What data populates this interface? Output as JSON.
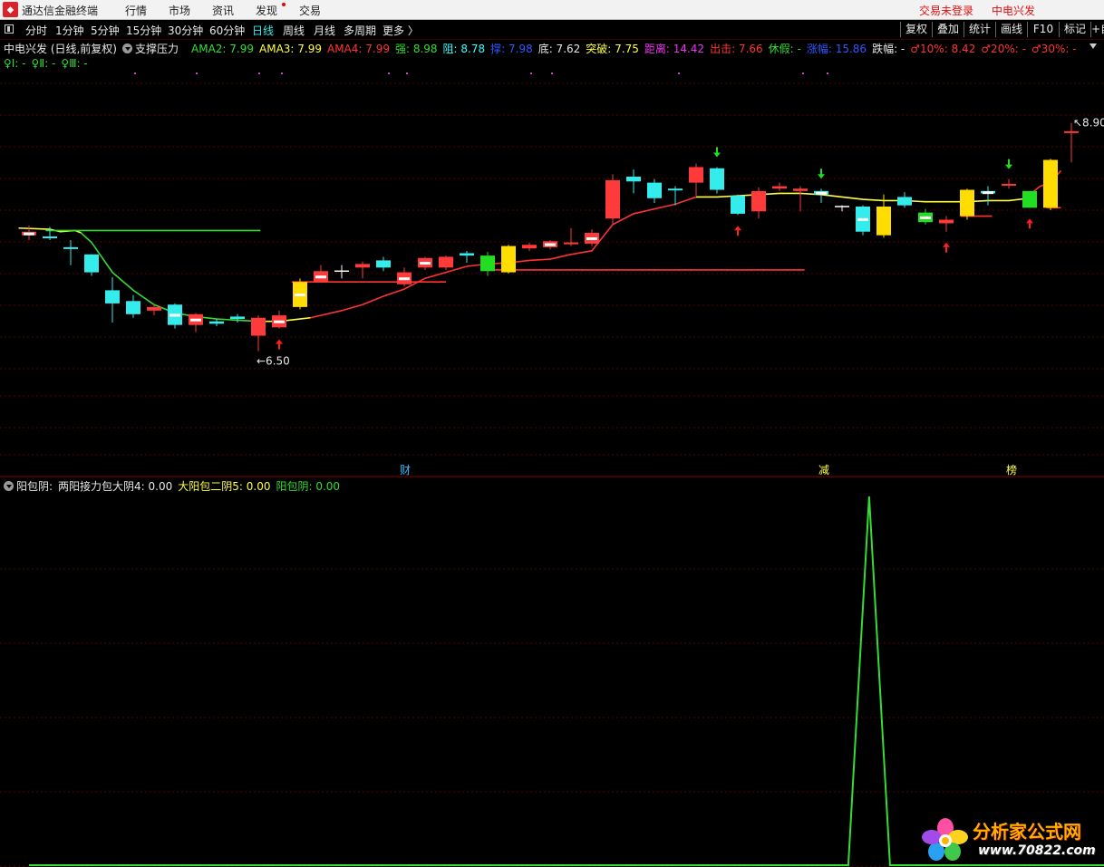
{
  "app": {
    "title": "通达信金融终端",
    "menu": [
      "行情",
      "市场",
      "资讯",
      "发现",
      "交易"
    ],
    "login_status": "交易未登录",
    "stock_name": "中电兴发"
  },
  "periods": [
    "分时",
    "1分钟",
    "5分钟",
    "15分钟",
    "30分钟",
    "60分钟",
    "日线",
    "周线",
    "月线",
    "多周期",
    "更多 〉"
  ],
  "active_period": "日线",
  "tools": [
    "复权",
    "叠加",
    "统计",
    "画线",
    "F10",
    "标记",
    "+自"
  ],
  "main_legend": {
    "title": "中电兴发 (日线,前复权)",
    "indicator": "支撑压力",
    "items": [
      {
        "text": "AMA2: 7.99",
        "color": "#33dd33"
      },
      {
        "text": "AMA3: 7.99",
        "color": "#ffff44"
      },
      {
        "text": "AMA4: 7.99",
        "color": "#ff3333"
      },
      {
        "text": "强: 8.98",
        "color": "#33dd33"
      },
      {
        "text": "阻: 8.78",
        "color": "#33ffff"
      },
      {
        "text": "撑: 7.98",
        "color": "#3355ff"
      },
      {
        "text": "底: 7.62",
        "color": "#e8e8e8"
      },
      {
        "text": "突破: 7.75",
        "color": "#ffff44"
      },
      {
        "text": "距离: 14.42",
        "color": "#ee33ee"
      },
      {
        "text": "出击: 7.66",
        "color": "#ff3333"
      },
      {
        "text": "休假: -",
        "color": "#33dd33"
      },
      {
        "text": "涨幅: 15.86",
        "color": "#3355ff"
      },
      {
        "text": "跌幅: -",
        "color": "#e8e8e8"
      },
      {
        "text": "♂10%: 8.42",
        "color": "#ff3333"
      },
      {
        "text": "♂20%: -",
        "color": "#ff3333"
      },
      {
        "text": "♂30%: -",
        "color": "#ff3333"
      }
    ],
    "line2": [
      {
        "text": "♀Ⅰ: -",
        "color": "#33dd33"
      },
      {
        "text": "♀Ⅱ: -",
        "color": "#33dd33"
      },
      {
        "text": "♀Ⅲ: -",
        "color": "#33dd33"
      }
    ]
  },
  "sub_legend": {
    "indicator": "阳包阴:",
    "items": [
      {
        "text": "两阳接力包大阴4: 0.00",
        "color": "#e8e8e8"
      },
      {
        "text": "大阳包二阴5: 0.00",
        "color": "#ffff44"
      },
      {
        "text": "阳包阴: 0.00",
        "color": "#33dd33"
      }
    ]
  },
  "annotations": {
    "high_label": "8.90",
    "low_label": "6.50",
    "tag_cai": "财",
    "tag_jian": "减",
    "tag_bang": "榜"
  },
  "chart_data": {
    "type": "candlestick",
    "period": "日线",
    "price_axis": {
      "min": 6.2,
      "max": 9.2
    },
    "candles": [
      {
        "o": 7.99,
        "h": 8.04,
        "l": 7.92,
        "c": 7.96,
        "style": "red"
      },
      {
        "o": 7.94,
        "h": 8.03,
        "l": 7.92,
        "c": 7.95,
        "style": "cyan"
      },
      {
        "o": 7.86,
        "h": 7.92,
        "l": 7.71,
        "c": 7.85,
        "style": "cyan"
      },
      {
        "o": 7.8,
        "h": 7.8,
        "l": 7.62,
        "c": 7.65,
        "style": "cyan"
      },
      {
        "o": 7.5,
        "h": 7.61,
        "l": 7.23,
        "c": 7.39,
        "style": "cyan"
      },
      {
        "o": 7.41,
        "h": 7.46,
        "l": 7.27,
        "c": 7.3,
        "style": "cyan"
      },
      {
        "o": 7.33,
        "h": 7.38,
        "l": 7.29,
        "c": 7.36,
        "style": "red"
      },
      {
        "o": 7.38,
        "h": 7.39,
        "l": 7.18,
        "c": 7.21,
        "style": "cyan"
      },
      {
        "o": 7.21,
        "h": 7.31,
        "l": 7.15,
        "c": 7.3,
        "style": "red"
      },
      {
        "o": 7.22,
        "h": 7.26,
        "l": 7.2,
        "c": 7.24,
        "style": "cyan"
      },
      {
        "o": 7.26,
        "h": 7.3,
        "l": 7.23,
        "c": 7.28,
        "style": "cyan"
      },
      {
        "o": 7.12,
        "h": 7.29,
        "l": 6.99,
        "c": 7.27,
        "style": "red"
      },
      {
        "o": 7.19,
        "h": 7.33,
        "l": 7.18,
        "c": 7.29,
        "style": "red"
      },
      {
        "o": 7.36,
        "h": 7.6,
        "l": 7.34,
        "c": 7.57,
        "style": "yellow"
      },
      {
        "o": 7.57,
        "h": 7.71,
        "l": 7.57,
        "c": 7.66,
        "style": "red"
      },
      {
        "o": 7.66,
        "h": 7.71,
        "l": 7.6,
        "c": 7.66,
        "style": "white"
      },
      {
        "o": 7.69,
        "h": 7.74,
        "l": 7.6,
        "c": 7.72,
        "style": "red"
      },
      {
        "o": 7.75,
        "h": 7.78,
        "l": 7.66,
        "c": 7.69,
        "style": "cyan"
      },
      {
        "o": 7.55,
        "h": 7.69,
        "l": 7.53,
        "c": 7.65,
        "style": "red"
      },
      {
        "o": 7.69,
        "h": 7.78,
        "l": 7.67,
        "c": 7.77,
        "style": "red"
      },
      {
        "o": 7.69,
        "h": 7.79,
        "l": 7.67,
        "c": 7.78,
        "style": "red"
      },
      {
        "o": 7.79,
        "h": 7.83,
        "l": 7.73,
        "c": 7.81,
        "style": "cyan"
      },
      {
        "o": 7.79,
        "h": 7.82,
        "l": 7.62,
        "c": 7.66,
        "style": "green"
      },
      {
        "o": 7.65,
        "h": 7.88,
        "l": 7.64,
        "c": 7.87,
        "style": "yellow"
      },
      {
        "o": 7.85,
        "h": 7.9,
        "l": 7.83,
        "c": 7.88,
        "style": "red"
      },
      {
        "o": 7.86,
        "h": 7.92,
        "l": 7.84,
        "c": 7.91,
        "style": "red"
      },
      {
        "o": 7.89,
        "h": 8.02,
        "l": 7.87,
        "c": 7.9,
        "style": "red"
      },
      {
        "o": 7.89,
        "h": 8.01,
        "l": 7.87,
        "c": 7.98,
        "style": "red"
      },
      {
        "o": 8.1,
        "h": 8.47,
        "l": 8.05,
        "c": 8.42,
        "style": "red"
      },
      {
        "o": 8.45,
        "h": 8.51,
        "l": 8.31,
        "c": 8.41,
        "style": "cyan"
      },
      {
        "o": 8.4,
        "h": 8.43,
        "l": 8.23,
        "c": 8.27,
        "style": "cyan"
      },
      {
        "o": 8.35,
        "h": 8.37,
        "l": 8.21,
        "c": 8.35,
        "style": "cyan"
      },
      {
        "o": 8.4,
        "h": 8.56,
        "l": 8.29,
        "c": 8.53,
        "style": "red"
      },
      {
        "o": 8.52,
        "h": 8.53,
        "l": 8.31,
        "c": 8.34,
        "style": "cyan"
      },
      {
        "o": 8.29,
        "h": 8.3,
        "l": 8.13,
        "c": 8.14,
        "style": "cyan"
      },
      {
        "o": 8.16,
        "h": 8.36,
        "l": 8.1,
        "c": 8.33,
        "style": "red"
      },
      {
        "o": 8.35,
        "h": 8.4,
        "l": 8.33,
        "c": 8.37,
        "style": "red"
      },
      {
        "o": 8.35,
        "h": 8.37,
        "l": 8.16,
        "c": 8.33,
        "style": "red"
      },
      {
        "o": 8.33,
        "h": 8.35,
        "l": 8.23,
        "c": 8.3,
        "style": "cyan"
      },
      {
        "o": 8.2,
        "h": 8.21,
        "l": 8.16,
        "c": 8.19,
        "style": "white"
      },
      {
        "o": 8.2,
        "h": 8.21,
        "l": 7.96,
        "c": 7.99,
        "style": "cyan"
      },
      {
        "o": 8.2,
        "h": 8.3,
        "l": 7.94,
        "c": 7.96,
        "style": "yellow"
      },
      {
        "o": 8.28,
        "h": 8.32,
        "l": 8.19,
        "c": 8.21,
        "style": "cyan"
      },
      {
        "o": 8.15,
        "h": 8.18,
        "l": 8.05,
        "c": 8.07,
        "style": "green"
      },
      {
        "o": 8.06,
        "h": 8.12,
        "l": 7.99,
        "c": 8.09,
        "style": "red"
      },
      {
        "o": 8.12,
        "h": 8.35,
        "l": 8.09,
        "c": 8.34,
        "style": "yellow"
      },
      {
        "o": 8.31,
        "h": 8.37,
        "l": 8.21,
        "c": 8.33,
        "style": "cyan"
      },
      {
        "o": 8.39,
        "h": 8.43,
        "l": 8.35,
        "c": 8.39,
        "style": "red"
      },
      {
        "o": 8.33,
        "h": 8.29,
        "l": 8.19,
        "c": 8.19,
        "style": "green"
      },
      {
        "o": 8.19,
        "h": 8.6,
        "l": 8.17,
        "c": 8.59,
        "style": "yellow"
      },
      {
        "o": 8.83,
        "h": 8.9,
        "l": 8.57,
        "c": 8.83,
        "style": "red"
      }
    ],
    "lines": [
      {
        "color": "#ffff44",
        "points": [
          [
            -0.5,
            8.02
          ],
          [
            1,
            8.01
          ],
          [
            1.5,
            7.99
          ],
          [
            2.2,
            8.0
          ],
          [
            2.5,
            7.98
          ]
        ]
      },
      {
        "color": "#33dd33",
        "points": [
          [
            2.5,
            7.98
          ],
          [
            3,
            7.9
          ],
          [
            4,
            7.65
          ],
          [
            5,
            7.5
          ],
          [
            6,
            7.38
          ],
          [
            7,
            7.31
          ],
          [
            8,
            7.28
          ],
          [
            9,
            7.26
          ],
          [
            10,
            7.25
          ],
          [
            11,
            7.24
          ]
        ]
      },
      {
        "color": "#ffff44",
        "points": [
          [
            11,
            7.24
          ],
          [
            12,
            7.24
          ],
          [
            13,
            7.26
          ],
          [
            13.5,
            7.27
          ]
        ]
      },
      {
        "color": "#ff3333",
        "points": [
          [
            13.5,
            7.27
          ],
          [
            14,
            7.29
          ],
          [
            15,
            7.33
          ],
          [
            16,
            7.38
          ],
          [
            17,
            7.45
          ],
          [
            18,
            7.51
          ],
          [
            19,
            7.6
          ],
          [
            20,
            7.65
          ],
          [
            21,
            7.7
          ],
          [
            22,
            7.72
          ],
          [
            23,
            7.73
          ],
          [
            24,
            7.75
          ],
          [
            25,
            7.76
          ],
          [
            26,
            7.8
          ],
          [
            27,
            7.83
          ],
          [
            28,
            8.05
          ],
          [
            29,
            8.14
          ],
          [
            30,
            8.18
          ],
          [
            31,
            8.22
          ],
          [
            32,
            8.28
          ]
        ]
      },
      {
        "color": "#ffff44",
        "points": [
          [
            32,
            8.28
          ],
          [
            33,
            8.28
          ],
          [
            34,
            8.29
          ],
          [
            35,
            8.3
          ],
          [
            36,
            8.31
          ],
          [
            37,
            8.31
          ],
          [
            38,
            8.3
          ],
          [
            39,
            8.28
          ],
          [
            40,
            8.26
          ],
          [
            41,
            8.25
          ],
          [
            42,
            8.25
          ],
          [
            43,
            8.24
          ],
          [
            44,
            8.24
          ],
          [
            45,
            8.24
          ],
          [
            46,
            8.25
          ],
          [
            47,
            8.25
          ],
          [
            48,
            8.27
          ]
        ]
      },
      {
        "color": "#ff3333",
        "points": [
          [
            48,
            8.3
          ],
          [
            48.5,
            8.37
          ],
          [
            49,
            8.4
          ],
          [
            49.5,
            8.5
          ]
        ]
      },
      {
        "color": "#33dd33",
        "points": [
          [
            0.8,
            8.0
          ],
          [
            11.1,
            8.0
          ]
        ]
      },
      {
        "color": "#ff3333",
        "points": [
          [
            12.6,
            7.57
          ],
          [
            20,
            7.57
          ]
        ]
      },
      {
        "color": "#ff3333",
        "points": [
          [
            21.8,
            7.67
          ],
          [
            37.2,
            7.67
          ]
        ]
      },
      {
        "color": "#ff3333",
        "points": [
          [
            44.7,
            8.12
          ],
          [
            46.2,
            8.12
          ]
        ]
      },
      {
        "color": "#ff3333",
        "points": [
          [
            48.8,
            8.19
          ],
          [
            49.5,
            8.19
          ]
        ]
      }
    ],
    "up_arrows": [
      12,
      34,
      44,
      48
    ],
    "down_arrows": [
      33,
      38,
      47
    ],
    "markers": [
      0,
      7,
      8,
      12,
      13,
      14,
      18,
      19,
      25,
      27,
      38,
      40,
      43,
      46
    ],
    "indicator": {
      "name": "阳包阴",
      "type": "line",
      "color": "#33dd33",
      "points": [
        [
          0,
          0
        ],
        [
          39.3,
          0
        ],
        [
          40.3,
          1.0
        ],
        [
          41.3,
          0
        ],
        [
          52,
          0
        ]
      ]
    }
  },
  "colors": {
    "red": "#ff3a3a",
    "cyan": "#35ecec",
    "yellow": "#ffdd00",
    "green": "#22dd22",
    "white": "#ffffff",
    "grid": "#5a0000"
  },
  "watermark": {
    "title": "分析家公式网",
    "url": "www.70822.com"
  }
}
